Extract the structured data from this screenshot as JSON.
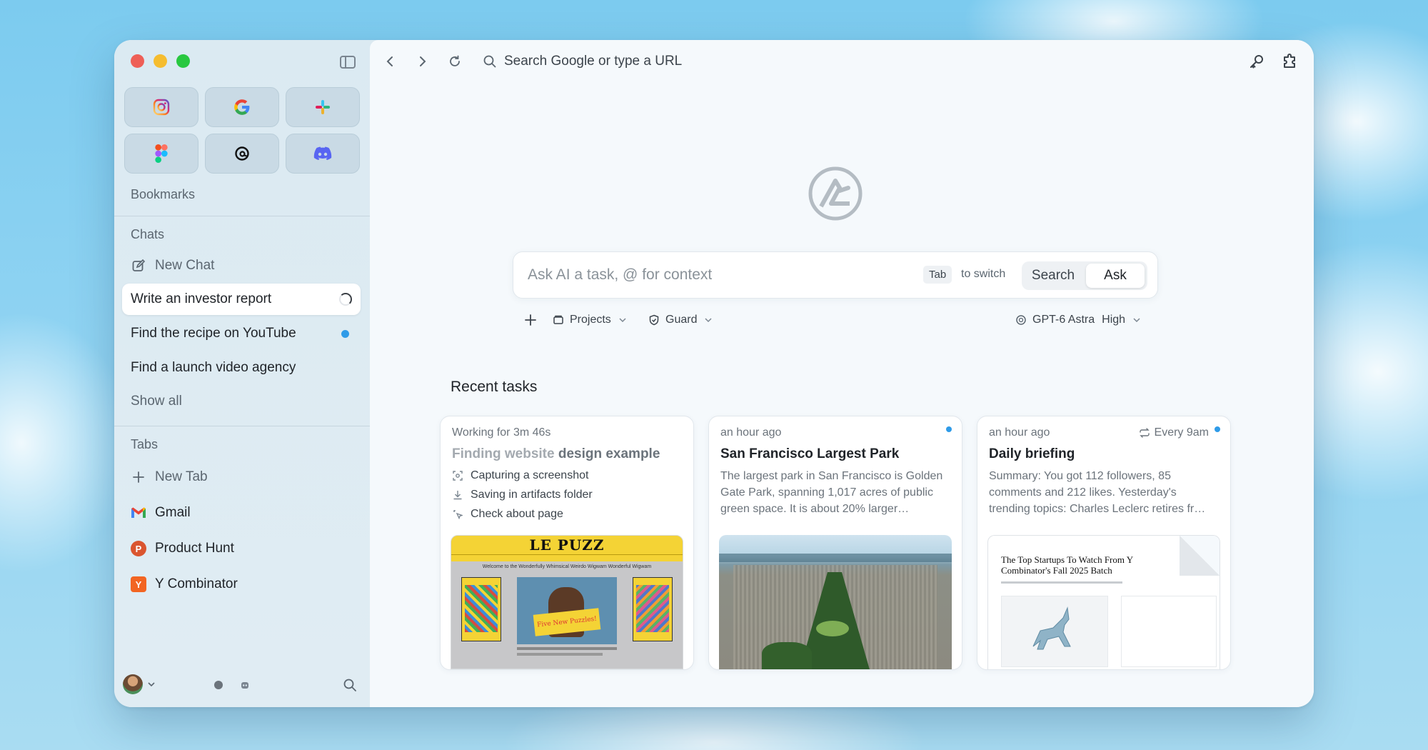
{
  "sidebar": {
    "favorites": [
      {
        "name": "instagram-icon",
        "color": "#d6249f"
      },
      {
        "name": "google-icon",
        "color": "#4285f4"
      },
      {
        "name": "slack-icon",
        "color": "#e01e5a"
      },
      {
        "name": "figma-icon",
        "color": "#f24e1e"
      },
      {
        "name": "threads-icon",
        "color": "#000000"
      },
      {
        "name": "discord-icon",
        "color": "#5865f2"
      }
    ],
    "bookmarks_label": "Bookmarks",
    "chats_label": "Chats",
    "new_chat": "New Chat",
    "chats": [
      {
        "label": "Write an investor report",
        "status": "loading"
      },
      {
        "label": "Find the recipe on YouTube",
        "status": "unread"
      },
      {
        "label": "Find a launch video agency",
        "status": "none"
      }
    ],
    "show_all": "Show all",
    "tabs_label": "Tabs",
    "new_tab": "New Tab",
    "tabs": [
      {
        "label": "Gmail",
        "icon": "gmail-icon"
      },
      {
        "label": "Product Hunt",
        "icon": "product-hunt-icon",
        "glyph": "P",
        "color": "#da552f"
      },
      {
        "label": "Y Combinator",
        "icon": "y-combinator-icon",
        "glyph": "Y",
        "color": "#f26522"
      }
    ]
  },
  "toolbar": {
    "url_placeholder": "Search Google or type a URL"
  },
  "prompt": {
    "placeholder": "Ask AI a task, @ for context",
    "kbd": "Tab",
    "switch_hint": "to switch",
    "mode_search": "Search",
    "mode_ask": "Ask",
    "projects": "Projects",
    "guard": "Guard",
    "model": "GPT-6 Astra",
    "effort": "High"
  },
  "recent": {
    "title": "Recent tasks",
    "cards": [
      {
        "meta": "Working for 3m 46s",
        "title_faded": "Finding website ",
        "title": "design example",
        "steps": [
          "Capturing a screenshot",
          "Saving in artifacts folder",
          "Check about page"
        ],
        "thumb": {
          "brand": "LE PUZZ",
          "tagline": "Welcome to the Wonderfully Whimsical Weirdo Wigwam Wonderful Wigwam",
          "badge": "Five New Puzzles!"
        }
      },
      {
        "meta": "an hour ago",
        "title": "San Francisco Largest Park",
        "body": "The largest park in San Francisco is Golden Gate Park, spanning 1,017 acres of public green space. It is about 20% larger…",
        "unread": true
      },
      {
        "meta": "an hour ago",
        "schedule": "Every 9am",
        "title": "Daily briefing",
        "body": "Summary: You got 112 followers, 85 comments and 212 likes. Yesterday's trending topics: Charles Leclerc retires fr…",
        "unread": true,
        "thumb": {
          "headline": "The Top Startups To Watch From Y Combinator's Fall 2025 Batch"
        }
      }
    ]
  },
  "colors": {
    "accent_blue": "#2f9be8",
    "sidebar_bg": "#dbeaf2",
    "main_bg": "#f5f9fc"
  }
}
